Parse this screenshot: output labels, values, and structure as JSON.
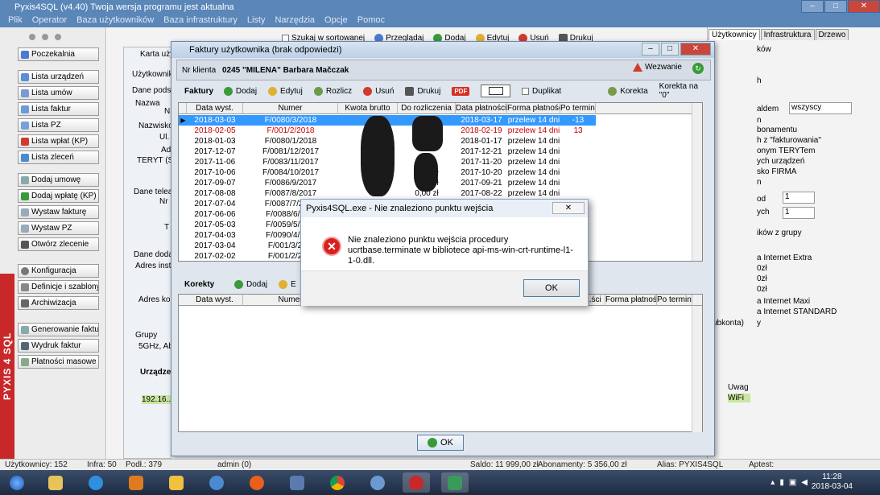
{
  "app": {
    "title": "Pyxis4SQL (v4.40)   Twoja wersja programu jest aktualna",
    "menu": [
      "Plik",
      "Operator",
      "Baza użytkowników",
      "Baza infrastruktury",
      "Listy",
      "Narzędzia",
      "Opcje",
      "Pomoc"
    ],
    "brand_vertical": "PYXIS 4 SQL"
  },
  "left_nav": [
    "Poczekalnia",
    "Lista urządzeń",
    "Lista umów",
    "Lista faktur",
    "Lista PZ",
    "Lista wpłat (KP)",
    "Lista zleceń",
    "Dodaj umowę",
    "Dodaj wpłatę (KP)",
    "Wystaw fakturę",
    "Wystaw PZ",
    "Otwórz zlecenie",
    "Konfiguracja",
    "Definicje i szablony",
    "Archiwizacja",
    "Generowanie faktur",
    "Wydruk faktur",
    "Płatności masowe"
  ],
  "bg_toolbar": {
    "checkbox": "Szukaj w sortowanej",
    "view": "Przeglądaj",
    "add": "Dodaj",
    "edit": "Edytuj",
    "delete": "Usuń",
    "print": "Drukuj"
  },
  "bg_window": {
    "title": "Karta użytkownika",
    "labels": [
      "Użytkownik",
      "Dane podst.",
      "Nazwa",
      "Nr",
      "Nazwisko",
      "Ul.",
      "Adr.",
      "TERYT (SI...",
      "Dane telea...",
      "Nr",
      "T",
      "Dane dodat.",
      "Adres insta...",
      "Adres kor...",
      "Grupy",
      "5GHz, Ab...",
      "Urządzenia",
      "192.16..."
    ]
  },
  "right_panel": {
    "tabs": [
      "Użytkownicy",
      "Infrastruktura",
      "Drzewo"
    ],
    "items": [
      "ków",
      "h",
      "aldem",
      "wszyscy",
      "n",
      "bonamentu",
      "h z \"fakturowania\"",
      "onym TERYTem",
      "ych urządzeń",
      "sko FIRMA",
      "n",
      "od",
      "1",
      "ych",
      "1",
      "ików z grupy",
      "a Internet Extra",
      "0zł",
      "0zł",
      "0zł",
      "a Internet Maxi",
      "a Internet STANDARD",
      "y",
      "subkonta)",
      "Uwag",
      "WiFi"
    ]
  },
  "invoices_window": {
    "title": "Faktury użytkownika (brak odpowiedzi)",
    "client_label": "Nr klienta",
    "client_value": "0245 \"MILENA\" Barbara Mačczak",
    "wezwanie": "Wezwanie",
    "section_faktury": "Faktury",
    "toolbar": {
      "add": "Dodaj",
      "edit": "Edytuj",
      "settle": "Rozlicz",
      "delete": "Usuń",
      "print": "Drukuj",
      "pdf": "PDF",
      "duplicate": "Duplikat",
      "correction": "Korekta",
      "correction_zero": "Korekta na \"0\""
    },
    "columns": [
      "Data wyst.",
      "Numer",
      "Kwota brutto",
      "Do rozliczenia",
      "Data płatności",
      "Forma płatności",
      "Po terminie"
    ],
    "rows": [
      {
        "date": "2018-03-03",
        "number": "F/0080/3/2018",
        "gross": "",
        "due": "",
        "paydate": "2018-03-17",
        "form": "przelew 14 dni",
        "late": "-13",
        "style": "sel"
      },
      {
        "date": "2018-02-05",
        "number": "F/001/2/2018",
        "gross": "",
        "due": "zł",
        "paydate": "2018-02-19",
        "form": "przelew 14 dni",
        "late": "13",
        "style": "red"
      },
      {
        "date": "2018-01-03",
        "number": "F/0080/1/2018",
        "gross": "",
        "due": "",
        "paydate": "2018-01-17",
        "form": "przelew 14 dni",
        "late": "",
        "style": ""
      },
      {
        "date": "2017-12-07",
        "number": "F/0081/12/2017",
        "gross": "",
        "due": "",
        "paydate": "2017-12-21",
        "form": "przelew 14 dni",
        "late": "",
        "style": ""
      },
      {
        "date": "2017-11-06",
        "number": "F/0083/11/2017",
        "gross": "",
        "due": "",
        "paydate": "2017-11-20",
        "form": "przelew 14 dni",
        "late": "",
        "style": ""
      },
      {
        "date": "2017-10-06",
        "number": "F/0084/10/2017",
        "gross": "",
        "due": "0,00 zł",
        "paydate": "2017-10-20",
        "form": "przelew 14 dni",
        "late": "",
        "style": ""
      },
      {
        "date": "2017-09-07",
        "number": "F/0086/9/2017",
        "gross": "",
        "due": "0,00 zł",
        "paydate": "2017-09-21",
        "form": "przelew 14 dni",
        "late": "",
        "style": ""
      },
      {
        "date": "2017-08-08",
        "number": "F/0087/8/2017",
        "gross": "",
        "due": "0,00 zł",
        "paydate": "2017-08-22",
        "form": "przelew 14 dni",
        "late": "",
        "style": ""
      },
      {
        "date": "2017-07-04",
        "number": "F/0087/7/2017",
        "gross": "",
        "due": "",
        "paydate": "",
        "form": "",
        "late": "",
        "style": ""
      },
      {
        "date": "2017-06-06",
        "number": "F/0088/6/20...",
        "gross": "",
        "due": "",
        "paydate": "",
        "form": "",
        "late": "",
        "style": ""
      },
      {
        "date": "2017-05-03",
        "number": "F/0059/5/20...",
        "gross": "",
        "due": "",
        "paydate": "",
        "form": "",
        "late": "",
        "style": ""
      },
      {
        "date": "2017-04-03",
        "number": "F/0090/4/20...",
        "gross": "",
        "due": "",
        "paydate": "",
        "form": "",
        "late": "",
        "style": ""
      },
      {
        "date": "2017-03-04",
        "number": "F/001/3/20...",
        "gross": "",
        "due": "",
        "paydate": "",
        "form": "",
        "late": "",
        "style": ""
      },
      {
        "date": "2017-02-02",
        "number": "F/001/2/20...",
        "gross": "",
        "due": "",
        "paydate": "",
        "form": "",
        "late": "",
        "style": ""
      }
    ],
    "section_korekty": "Korekty",
    "korekty_toolbar": {
      "add": "Dodaj",
      "edit": "E"
    },
    "korekty_columns": [
      "Data wyst.",
      "Numer",
      "...ści",
      "Forma płatności",
      "Po terminie"
    ],
    "ok": "OK"
  },
  "dialog": {
    "title": "Pyxis4SQL.exe - Nie znaleziono punktu wejścia",
    "close": "✕",
    "message": "Nie znaleziono punktu wejścia procedury ucrtbase.terminate w bibliotece api-ms-win-crt-runtime-l1-1-0.dll.",
    "ok": "OK"
  },
  "status": {
    "users": "Użytkownicy: 152",
    "infra": "Infra: 50",
    "podl": "Podł.: 379",
    "admin": "admin (0)",
    "saldo": "Saldo: 11 999,00 zł",
    "abon": "Abonamenty: 5 356,00 zł",
    "alias": "Alias: PYXIS4SQL",
    "aptest": "Aptest:"
  },
  "taskbar": {
    "time": "11:28",
    "date": "2018-03-04"
  }
}
